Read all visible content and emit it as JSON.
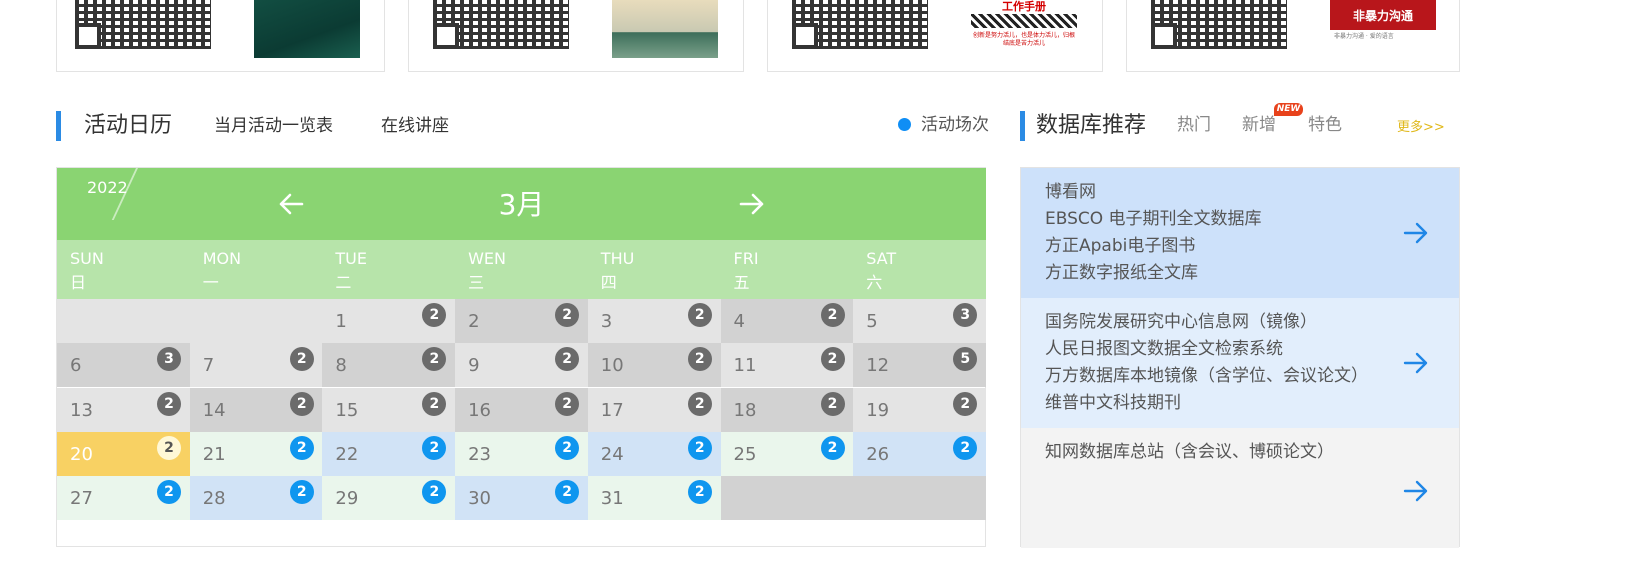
{
  "books": [
    {
      "cover_title": ""
    },
    {
      "cover_title": ""
    },
    {
      "cover_title": "工作手册",
      "cover_note": "创新是努力活儿，也是体力活儿，归根结底是苦力活儿"
    },
    {
      "cover_title": "非暴力沟通",
      "cover_note": "非暴力沟通 · 爱的语言"
    }
  ],
  "activity": {
    "title": "活动日历",
    "tabs": [
      "当月活动一览表",
      "在线讲座"
    ],
    "legend": "活动场次"
  },
  "calendar": {
    "year": "2022",
    "month": "3月",
    "weekdays": [
      {
        "en": "SUN",
        "cn": "日"
      },
      {
        "en": "MON",
        "cn": "一"
      },
      {
        "en": "TUE",
        "cn": "二"
      },
      {
        "en": "WEN",
        "cn": "三"
      },
      {
        "en": "THU",
        "cn": "四"
      },
      {
        "en": "FRI",
        "cn": "五"
      },
      {
        "en": "SAT",
        "cn": "六"
      }
    ],
    "days": [
      {
        "d": "1",
        "count": "2"
      },
      {
        "d": "2",
        "count": "2"
      },
      {
        "d": "3",
        "count": "2"
      },
      {
        "d": "4",
        "count": "2"
      },
      {
        "d": "5",
        "count": "3"
      },
      {
        "d": "6",
        "count": "3"
      },
      {
        "d": "7",
        "count": "2"
      },
      {
        "d": "8",
        "count": "2"
      },
      {
        "d": "9",
        "count": "2"
      },
      {
        "d": "10",
        "count": "2"
      },
      {
        "d": "11",
        "count": "2"
      },
      {
        "d": "12",
        "count": "5"
      },
      {
        "d": "13",
        "count": "2"
      },
      {
        "d": "14",
        "count": "2"
      },
      {
        "d": "15",
        "count": "2"
      },
      {
        "d": "16",
        "count": "2"
      },
      {
        "d": "17",
        "count": "2"
      },
      {
        "d": "18",
        "count": "2"
      },
      {
        "d": "19",
        "count": "2"
      },
      {
        "d": "20",
        "count": "2"
      },
      {
        "d": "21",
        "count": "2"
      },
      {
        "d": "22",
        "count": "2"
      },
      {
        "d": "23",
        "count": "2"
      },
      {
        "d": "24",
        "count": "2"
      },
      {
        "d": "25",
        "count": "2"
      },
      {
        "d": "26",
        "count": "2"
      },
      {
        "d": "27",
        "count": "2"
      },
      {
        "d": "28",
        "count": "2"
      },
      {
        "d": "29",
        "count": "2"
      },
      {
        "d": "30",
        "count": "2"
      },
      {
        "d": "31",
        "count": "2"
      }
    ],
    "today": "20"
  },
  "database": {
    "title": "数据库推荐",
    "tabs": [
      "热门",
      "新增",
      "特色"
    ],
    "new_badge": "NEW",
    "more": "更多>>",
    "groups": [
      [
        "博看网",
        "EBSCO 电子期刊全文数据库",
        "方正Apabi电子图书",
        "方正数字报纸全文库"
      ],
      [
        "国务院发展研究中心信息网（镜像）",
        "人民日报图文数据全文检索系统",
        "万方数据库本地镜像（含学位、会议论文）",
        "维普中文科技期刊"
      ],
      [
        "知网数据库总站（含会议、博硕论文）"
      ]
    ]
  },
  "colors": {
    "accent_bar": "#2b8be4",
    "calendar_header": "#8ad472",
    "weekday_row": "#b7e4aa",
    "today": "#f8d163",
    "badge_past": "#6b6b6b",
    "badge_future": "#0f96ef",
    "new_badge": "#e8421c",
    "more_link": "#e0b81a"
  }
}
